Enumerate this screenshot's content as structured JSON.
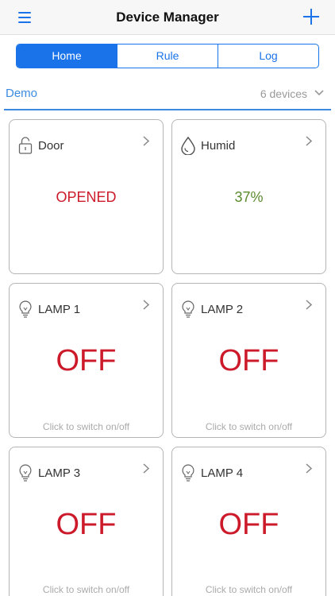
{
  "navbar": {
    "title": "Device Manager"
  },
  "tabs": [
    {
      "label": "Home",
      "active": true
    },
    {
      "label": "Rule",
      "active": false
    },
    {
      "label": "Log",
      "active": false
    }
  ],
  "group": {
    "name": "Demo",
    "count_label": "6 devices"
  },
  "devices": [
    {
      "name": "Door",
      "icon": "lock-icon",
      "value": "OPENED",
      "value_color": "#cc1a2b"
    },
    {
      "name": "Humid",
      "icon": "water-drop-icon",
      "value": "37%",
      "value_color": "#5a8a2e"
    },
    {
      "name": "LAMP 1",
      "icon": "lightbulb-icon",
      "value": "OFF",
      "hint": "Click to switch on/off"
    },
    {
      "name": "LAMP 2",
      "icon": "lightbulb-icon",
      "value": "OFF",
      "hint": "Click to switch on/off"
    },
    {
      "name": "LAMP 3",
      "icon": "lightbulb-icon",
      "value": "OFF",
      "hint": "Click to switch on/off"
    },
    {
      "name": "LAMP 4",
      "icon": "lightbulb-icon",
      "value": "OFF",
      "hint": "Click to switch on/off"
    }
  ],
  "colors": {
    "accent": "#1a73e8",
    "off": "#cc1a2b"
  }
}
